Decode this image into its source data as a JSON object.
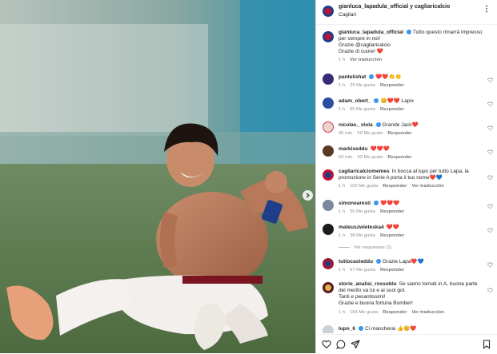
{
  "header": {
    "username": "gianluca_lapadula_official y cagliaricalcio",
    "location": "Cagliari",
    "more_icon": "more-dots-icon"
  },
  "caption": {
    "username": "gianluca_lapadula_official",
    "line1": "Tutto questo rimarrà impresso per sempre in noi!",
    "line2": "Grazie @cagliaricalcio",
    "line3": "Grazie di cuore! ❤️",
    "time": "1 h",
    "translate": "Ver traducción"
  },
  "comments": [
    {
      "user": "pantelishat",
      "text": "❤️❤️👏👏",
      "time": "1 h",
      "likes": "29 Me gusta",
      "reply": "Responder"
    },
    {
      "user": "adam_obert_",
      "text": "😊❤️❤️ Lapix",
      "time": "1 h",
      "likes": "65 Me gusta",
      "reply": "Responder"
    },
    {
      "user": "nicolas._viola",
      "text": "Grande Jack❤️",
      "time": "46 min",
      "likes": "59 Me gusta",
      "reply": "Responder"
    },
    {
      "user": "markixeddu",
      "text": "❤️❤️❤️",
      "time": "54 min",
      "likes": "43 Me gusta",
      "reply": "Responder"
    },
    {
      "user": "cagliaricalciomemes",
      "text": "In bocca al lupo per tutto Lapa, la promozione in Serie A porta il tuo nome❤️💙",
      "time": "1 h",
      "likes": "100 Me gusta",
      "reply": "Responder",
      "translate": "Ver traducción"
    },
    {
      "user": "simonearesti",
      "text": "❤️❤️❤️",
      "time": "1 h",
      "likes": "55 Me gusta",
      "reply": "Responder"
    },
    {
      "user": "mateuszwieteska4",
      "text": "❤️❤️",
      "time": "1 h",
      "likes": "38 Me gusta",
      "reply": "Responder",
      "replies": "Ver respuestas (1)"
    },
    {
      "user": "tuttocasteddu",
      "text": "Grazie Lapa❤️💙",
      "time": "1 h",
      "likes": "57 Me gusta",
      "reply": "Responder"
    },
    {
      "user": "storie_analisi_rossoblu",
      "text": "Se siamo tornati in A, buona parte del merito va lui e ai suoi gol.",
      "text2": "Tanti e pesantissimi!",
      "text3": "Grazie e buona fortuna Bomber!",
      "time": "1 h",
      "likes": "164 Me gusta",
      "reply": "Responder",
      "translate": "Ver traducción"
    },
    {
      "user": "lupo_6",
      "text": "Ci mancherai 👍😊❤️"
    }
  ],
  "actions": {
    "like_icon": "heart-icon",
    "comment_icon": "comment-icon",
    "share_icon": "share-icon",
    "save_icon": "bookmark-icon"
  },
  "colors": {
    "verified": "#3897f0",
    "heart": "#ed4956",
    "muted": "#8e8e8e"
  }
}
